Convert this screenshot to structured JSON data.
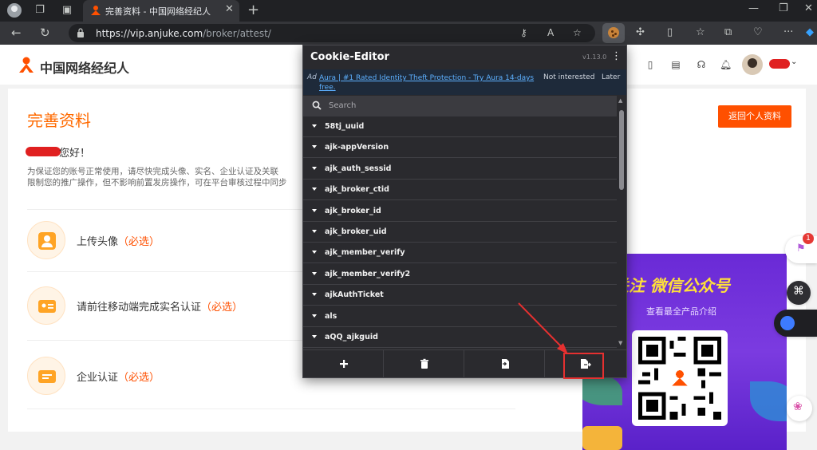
{
  "browser": {
    "tab_title": "完善资料 - 中国网络经纪人",
    "url_host": "https://vip.anjuke.com",
    "url_path": "/broker/attest/"
  },
  "site": {
    "logo_text": "中国网络经纪人",
    "page_title": "完善资料",
    "back_button": "返回个人资料",
    "greeting": "您好！",
    "notice_line1": "为保证您的账号正常使用，请尽快完成头像、实名、企业认证及关联",
    "notice_line2": "限制您的推广操作，但不影响前置发房操作，可在平台审核过程中同步",
    "steps": [
      {
        "label": "上传头像",
        "required": "（必选）"
      },
      {
        "label": "请前往移动端完成实名认证",
        "required": "（必选）"
      },
      {
        "label": "企业认证",
        "required": "（必选）"
      }
    ],
    "promo_title": "关注 微信公众号",
    "promo_sub": "查看最全产品介绍",
    "float_badge": "1"
  },
  "cookie_editor": {
    "title": "Cookie-Editor",
    "version": "v1.13.0",
    "ad_tag": "Ad",
    "ad_text": "Aura | #1 Rated Identity Theft Protection - Try Aura 14-days free.",
    "ad_not_interested": "Not interested",
    "ad_later": "Later",
    "search_placeholder": "Search",
    "cookies": [
      "58tj_uuid",
      "ajk-appVersion",
      "ajk_auth_sessid",
      "ajk_broker_ctid",
      "ajk_broker_id",
      "ajk_broker_uid",
      "ajk_member_verify",
      "ajk_member_verify2",
      "ajkAuthTicket",
      "als",
      "aQQ_ajkguid"
    ],
    "footer_buttons": [
      "add-icon",
      "delete-icon",
      "import-icon",
      "export-icon"
    ]
  },
  "colors": {
    "accent": "#ff5000",
    "popup_bg": "#2a2a2e",
    "highlight": "#e53030"
  }
}
